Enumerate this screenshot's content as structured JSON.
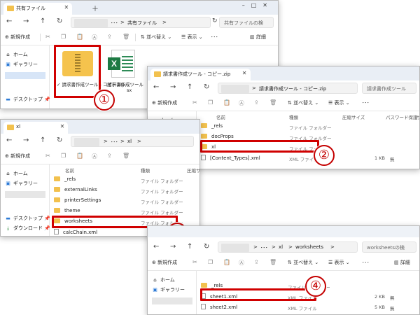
{
  "common": {
    "new": "新規作成",
    "sort": "並べ替え",
    "view": "表示",
    "details": "詳細",
    "more": "･･･",
    "home": "ホーム",
    "gallery": "ギャラリー",
    "desktop": "デスクトップ",
    "downloads": "ダウンロード",
    "col_name": "名前",
    "col_type": "種類",
    "col_compressed": "圧縮サイズ",
    "col_protect": "パスワード保護",
    "col_size": "サ",
    "folder": "ファイル フォルダー",
    "xml_file": "XML ファイル",
    "no": "無",
    "chevron": ">",
    "ellipsis": "･･･"
  },
  "win1": {
    "tab": "共有ファイル",
    "path": "共有ファイル",
    "search": "共有ファイルの検",
    "files": [
      {
        "name": "請求書作成ツール - コピー.zip"
      },
      {
        "name": "請求書作成ツール",
        "ext": "sx"
      }
    ]
  },
  "win2": {
    "tab": "請求書作成ツール - コピー.zip",
    "path": "請求書作成ツール - コピー.zip",
    "search": "請求書作成ツール",
    "rows": [
      {
        "name": "_rels",
        "type": "ファイル フォルダー"
      },
      {
        "name": "docProps",
        "type": "ファイル フォルダー"
      },
      {
        "name": "xl",
        "type": "ファイル フォルダー"
      },
      {
        "name": "[Content_Types].xml",
        "type": "XML ファイル",
        "size": "1 KB",
        "prot": "無"
      }
    ]
  },
  "win3": {
    "tab": "xl",
    "path": "xl",
    "rows": [
      {
        "name": "_rels",
        "type": "ファイル フォルダー"
      },
      {
        "name": "externalLinks",
        "type": "ファイル フォルダー"
      },
      {
        "name": "printerSettings",
        "type": "ファイル フォルダー"
      },
      {
        "name": "theme",
        "type": "ファイル フォルダー"
      },
      {
        "name": "worksheets",
        "type": "ファイル フォルダー"
      },
      {
        "name": "calcChain.xml",
        "type": ""
      }
    ]
  },
  "win4": {
    "path1": "xl",
    "path2": "worksheets",
    "search": "worksheetsの検",
    "rows": [
      {
        "name": "_rels",
        "type": "ファイル フォルダー"
      },
      {
        "name": "sheet1.xml",
        "type": "XML ファイル",
        "size": "2 KB",
        "prot": "無"
      },
      {
        "name": "sheet2.xml",
        "type": "XML ファイル",
        "size": "5 KB",
        "prot": "無"
      }
    ]
  },
  "badges": [
    "①",
    "②",
    "③",
    "④"
  ],
  "colors": {
    "highlight": "#d00000",
    "folder": "#f2c14e",
    "excel": "#1d7a43"
  }
}
